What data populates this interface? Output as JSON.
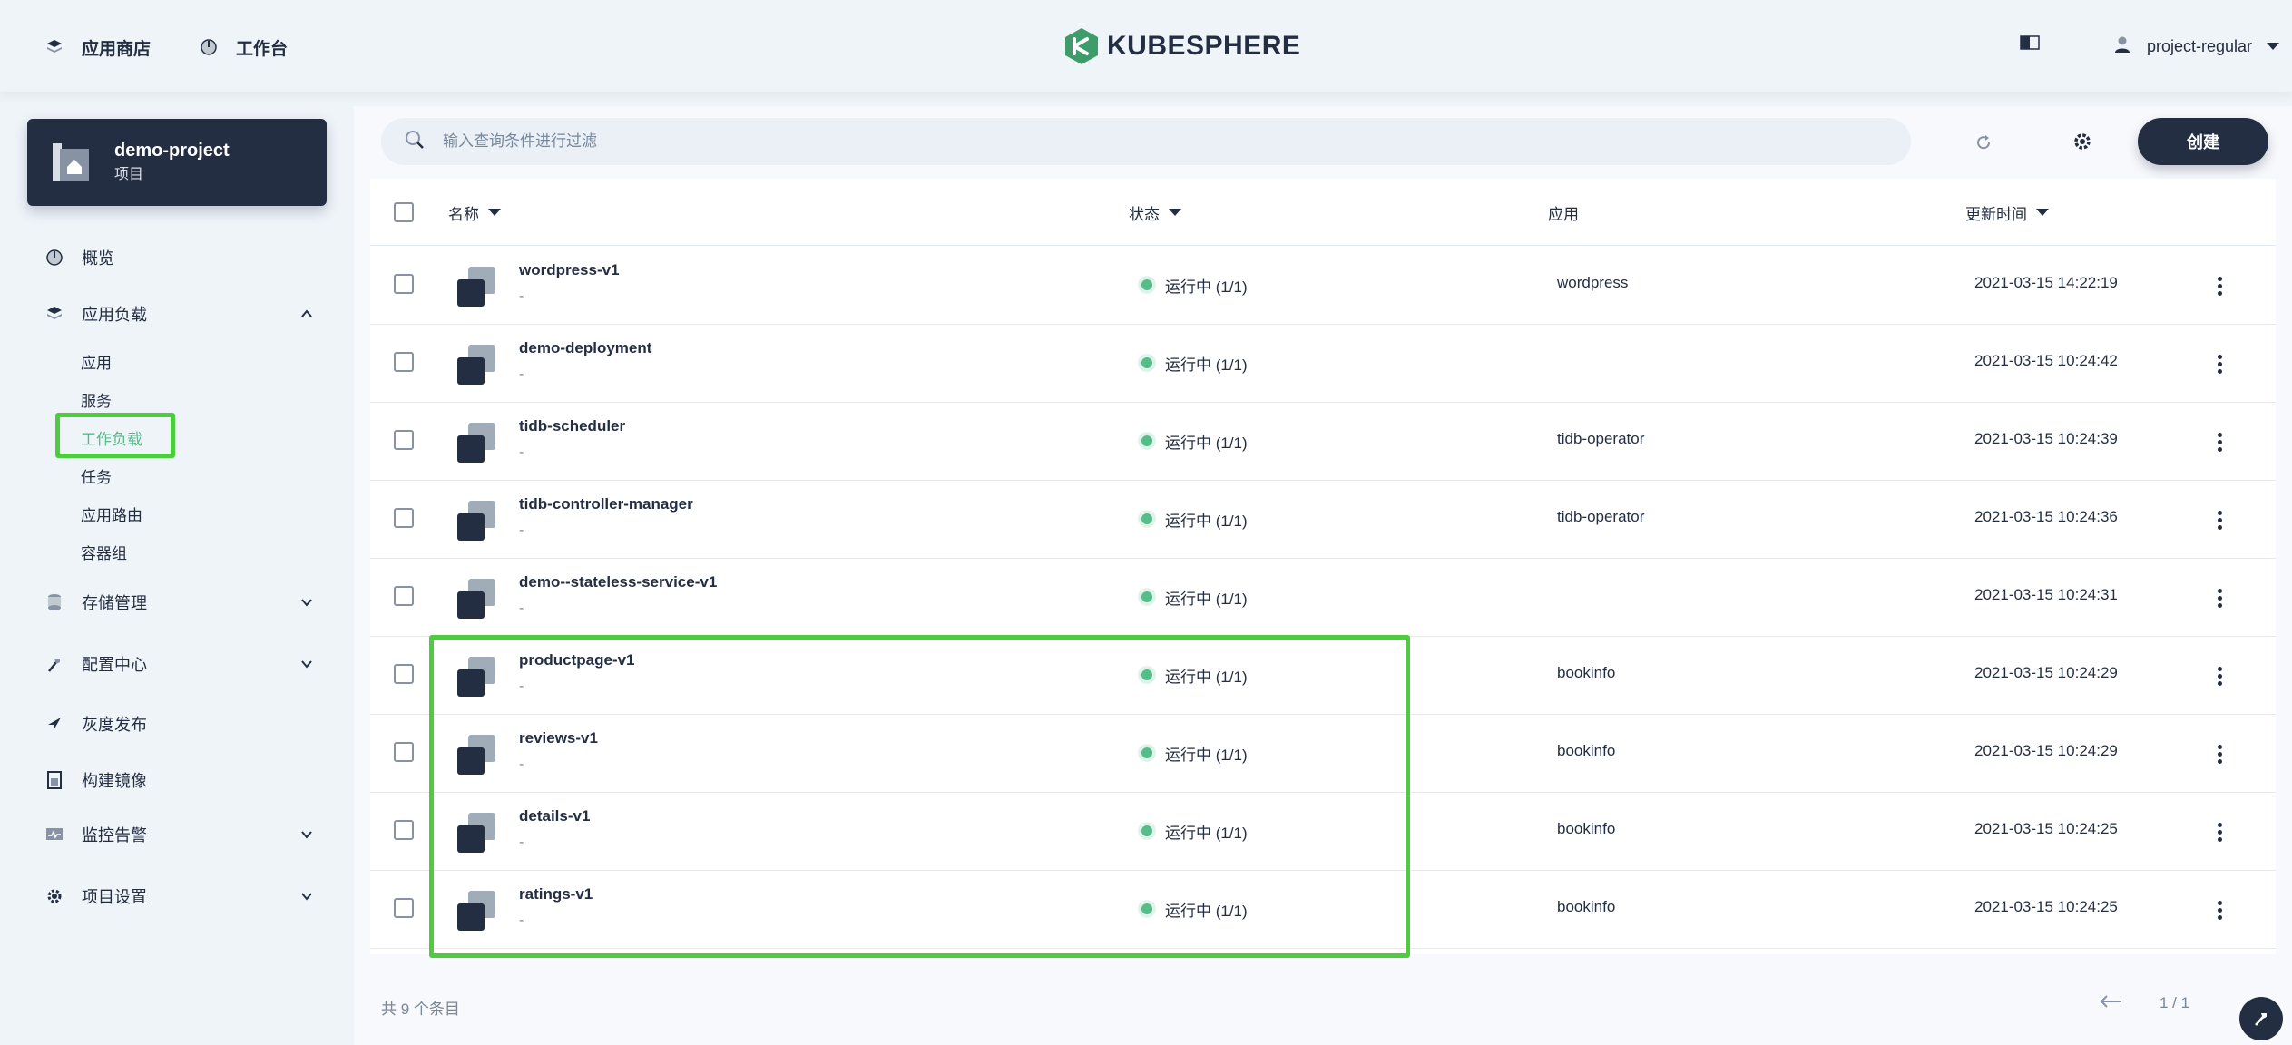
{
  "topbar": {
    "nav_store": "应用商店",
    "nav_workbench": "工作台",
    "logo_text": "KUBESPHERE",
    "username": "project-regular"
  },
  "sidebar": {
    "project_name": "demo-project",
    "project_type": "项目",
    "items": [
      {
        "label": "概览",
        "icon": "dashboard-icon"
      },
      {
        "label": "应用负载",
        "icon": "appstore-icon",
        "expanded": true
      },
      {
        "label": "存储管理",
        "icon": "storage-icon"
      },
      {
        "label": "配置中心",
        "icon": "hammer-icon"
      },
      {
        "label": "灰度发布",
        "icon": "bird-icon"
      },
      {
        "label": "构建镜像",
        "icon": "image-builder-icon"
      },
      {
        "label": "监控告警",
        "icon": "monitor-icon"
      },
      {
        "label": "项目设置",
        "icon": "gear-icon"
      }
    ],
    "sub_items": [
      "应用",
      "服务",
      "工作负载",
      "任务",
      "应用路由",
      "容器组"
    ],
    "active_sub": "工作负载"
  },
  "toolbar": {
    "search_placeholder": "输入查询条件进行过滤",
    "create_label": "创建"
  },
  "table": {
    "headers": {
      "name": "名称",
      "status": "状态",
      "app": "应用",
      "updated": "更新时间"
    },
    "rows": [
      {
        "name": "wordpress-v1",
        "desc": "-",
        "status": "运行中 (1/1)",
        "app": "wordpress",
        "time": "2021-03-15 14:22:19"
      },
      {
        "name": "demo-deployment",
        "desc": "-",
        "status": "运行中 (1/1)",
        "app": "",
        "time": "2021-03-15 10:24:42"
      },
      {
        "name": "tidb-scheduler",
        "desc": "-",
        "status": "运行中 (1/1)",
        "app": "tidb-operator",
        "time": "2021-03-15 10:24:39"
      },
      {
        "name": "tidb-controller-manager",
        "desc": "-",
        "status": "运行中 (1/1)",
        "app": "tidb-operator",
        "time": "2021-03-15 10:24:36"
      },
      {
        "name": "demo--stateless-service-v1",
        "desc": "-",
        "status": "运行中 (1/1)",
        "app": "",
        "time": "2021-03-15 10:24:31"
      },
      {
        "name": "productpage-v1",
        "desc": "-",
        "status": "运行中 (1/1)",
        "app": "bookinfo",
        "time": "2021-03-15 10:24:29"
      },
      {
        "name": "reviews-v1",
        "desc": "-",
        "status": "运行中 (1/1)",
        "app": "bookinfo",
        "time": "2021-03-15 10:24:29"
      },
      {
        "name": "details-v1",
        "desc": "-",
        "status": "运行中 (1/1)",
        "app": "bookinfo",
        "time": "2021-03-15 10:24:25"
      },
      {
        "name": "ratings-v1",
        "desc": "-",
        "status": "运行中 (1/1)",
        "app": "bookinfo",
        "time": "2021-03-15 10:24:25"
      }
    ]
  },
  "footer": {
    "total": "共 9 个条目",
    "page": "1 / 1"
  },
  "colors": {
    "dark": "#242e42",
    "running": "#55bc8a",
    "highlight": "#4ecb3e"
  }
}
